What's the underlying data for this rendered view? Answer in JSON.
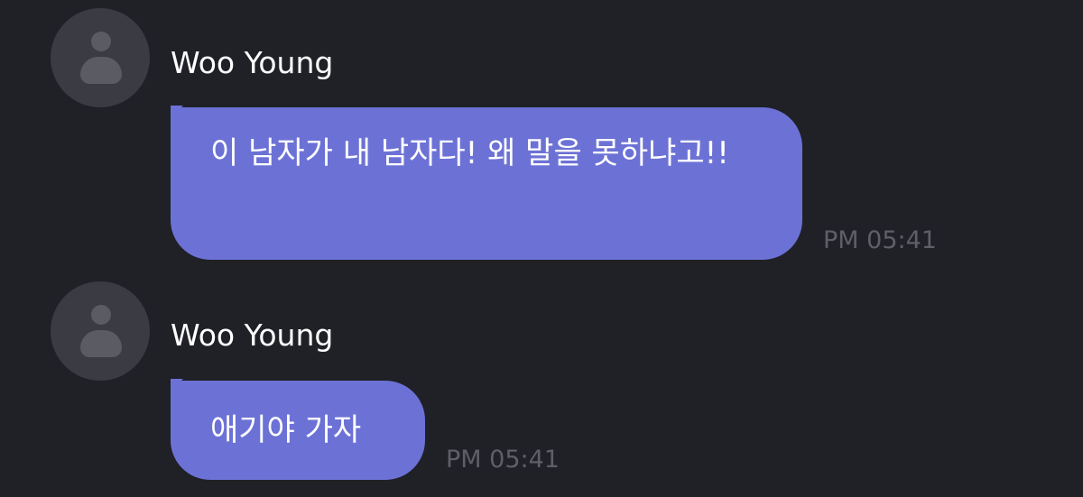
{
  "messages": [
    {
      "sender": "Woo Young",
      "text": "이 남자가 내 남자다! 왜 말을 못하냐고!!",
      "time": "PM 05:41"
    },
    {
      "sender": "Woo Young",
      "text": "애기야 가자",
      "time": "PM 05:41"
    }
  ],
  "colors": {
    "background": "#202027",
    "bubble": "#6c72d5",
    "avatar": "#3a3b43",
    "timestamp": "#5e5f68"
  },
  "icons": {
    "avatar": "user-placeholder-icon"
  }
}
